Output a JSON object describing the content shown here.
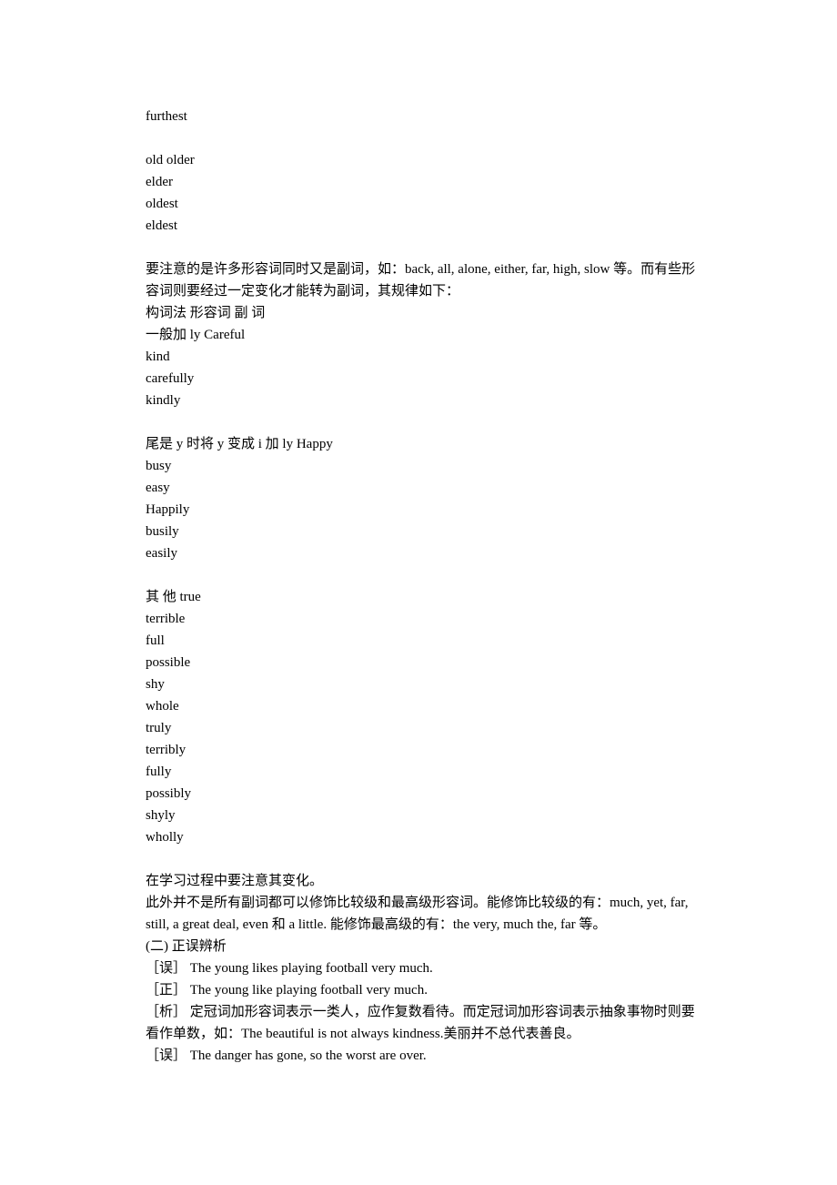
{
  "lines": [
    {
      "text": "furthest"
    },
    {
      "blank": true
    },
    {
      "text": "old older"
    },
    {
      "text": "elder"
    },
    {
      "text": " oldest"
    },
    {
      "text": "eldest"
    },
    {
      "blank": true
    },
    {
      "text": "要注意的是许多形容词同时又是副词，如：back, all, alone, either, far, high, slow 等。而有些形容词则要经过一定变化才能转为副词，其规律如下："
    },
    {
      "text": "构词法  形容词  副  词"
    },
    {
      "text": "一般加 ly Careful"
    },
    {
      "text": "kind"
    },
    {
      "text": " carefully"
    },
    {
      "text": "kindly"
    },
    {
      "blank": true
    },
    {
      "text": "尾是 y 时将 y 变成 i 加 ly Happy"
    },
    {
      "text": "busy"
    },
    {
      "text": "easy"
    },
    {
      "text": " Happily"
    },
    {
      "text": "busily"
    },
    {
      "text": "easily"
    },
    {
      "blank": true
    },
    {
      "text": "其  他 true"
    },
    {
      "text": "terrible"
    },
    {
      "text": "full"
    },
    {
      "text": "possible"
    },
    {
      "text": "shy"
    },
    {
      "text": "whole"
    },
    {
      "text": " truly"
    },
    {
      "text": "terribly"
    },
    {
      "text": "fully"
    },
    {
      "text": "possibly"
    },
    {
      "text": "shyly"
    },
    {
      "text": "wholly"
    },
    {
      "blank": true
    },
    {
      "text": "在学习过程中要注意其变化。"
    },
    {
      "text": "此外并不是所有副词都可以修饰比较级和最高级形容词。能修饰比较级的有：much, yet, far, still, a great deal, even  和 a little.  能修饰最高级的有：the very, much the, far 等。"
    },
    {
      "text": "(二)  正误辨析"
    },
    {
      "text": "［误］  The young likes playing football very much."
    },
    {
      "text": "［正］  The young like playing football very much."
    },
    {
      "text": "［析］  定冠词加形容词表示一类人，应作复数看待。而定冠词加形容词表示抽象事物时则要看作单数，如：The beautiful is not always kindness.美丽并不总代表善良。"
    },
    {
      "text": "［误］  The danger has gone, so the worst are over."
    }
  ]
}
